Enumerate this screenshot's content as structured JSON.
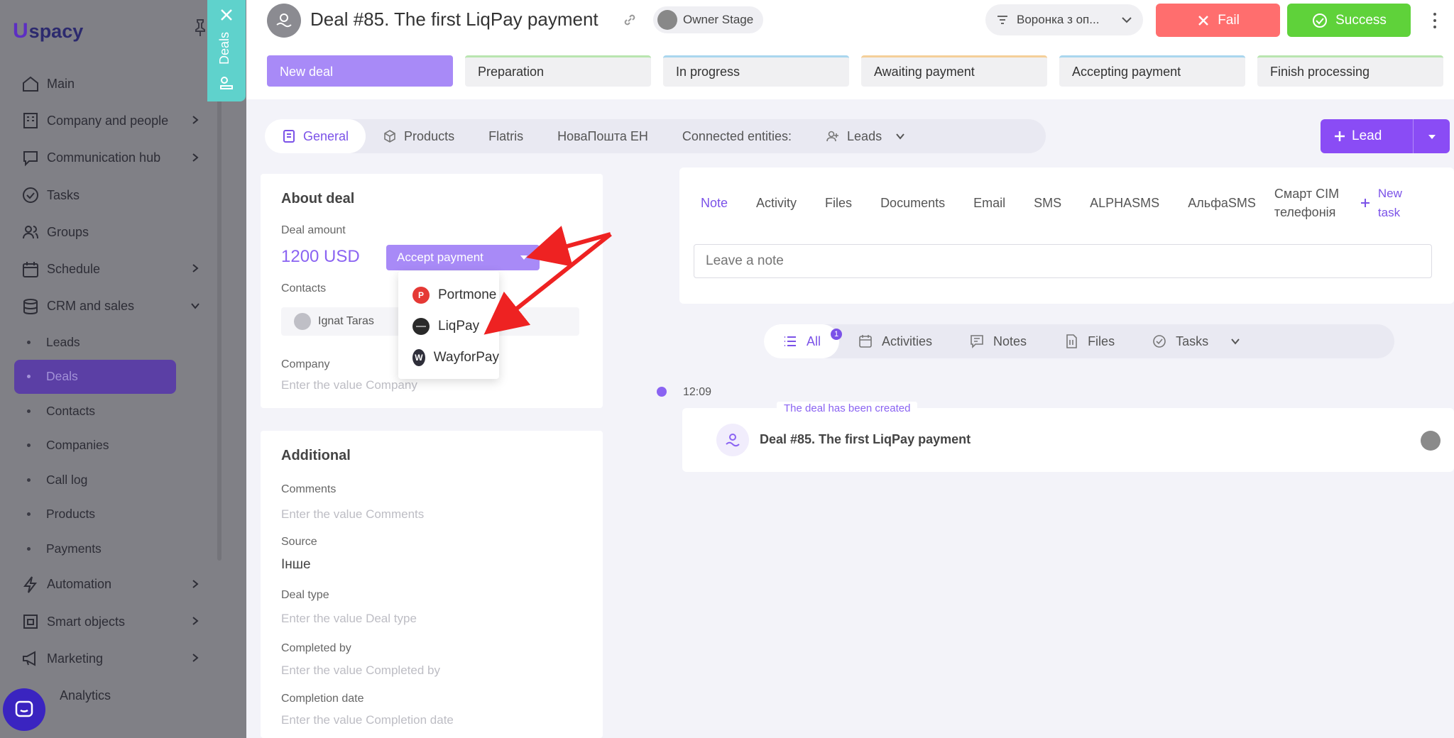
{
  "sidebar": {
    "logo": "spacy",
    "logo_mark": "U",
    "items": [
      {
        "label": "Main",
        "icon": "home-icon"
      },
      {
        "label": "Company and people",
        "icon": "building-icon",
        "expandable": true
      },
      {
        "label": "Communication hub",
        "icon": "chat-icon",
        "expandable": true
      },
      {
        "label": "Tasks",
        "icon": "check-circle-icon"
      },
      {
        "label": "Groups",
        "icon": "users-icon"
      },
      {
        "label": "Schedule",
        "icon": "calendar-icon",
        "expandable": true
      },
      {
        "label": "CRM and sales",
        "icon": "database-icon",
        "expanded": true
      }
    ],
    "crm_sub": [
      "Leads",
      "Deals",
      "Contacts",
      "Companies",
      "Call log",
      "Products",
      "Payments"
    ],
    "items_after": [
      {
        "label": "Automation",
        "icon": "bolt-icon",
        "expandable": true
      },
      {
        "label": "Smart objects",
        "icon": "cube-icon",
        "expandable": true
      },
      {
        "label": "Marketing",
        "icon": "megaphone-icon",
        "expandable": true
      },
      {
        "label": "Analytics",
        "icon": "chart-icon"
      }
    ]
  },
  "deals_tab": {
    "label": "Deals"
  },
  "header": {
    "title": "Deal #85. The first LiqPay payment",
    "owner_stage": "Owner Stage",
    "funnel": "Воронка з оп...",
    "fail_label": "Fail",
    "success_label": "Success"
  },
  "stages": [
    {
      "label": "New deal",
      "color": "#a88af7",
      "active": true
    },
    {
      "label": "Preparation",
      "color": "#b9e5b0"
    },
    {
      "label": "In progress",
      "color": "#a9d6ee"
    },
    {
      "label": "Awaiting payment",
      "color": "#f4cf99"
    },
    {
      "label": "Accepting payment",
      "color": "#a9d6ee"
    },
    {
      "label": "Finish processing",
      "color": "#b9e5b0"
    }
  ],
  "tabs": {
    "general": "General",
    "products": "Products",
    "flatris": "Flatris",
    "novaposhta": "НоваПошта ЕН",
    "connected": "Connected entities:",
    "leads": "Leads"
  },
  "lead_button": "Lead",
  "about": {
    "heading": "About deal",
    "deal_amount_label": "Deal amount",
    "deal_amount": "1200 USD",
    "accept_payment": "Accept payment",
    "contacts_label": "Contacts",
    "contact_name": "Ignat Taras",
    "company_label": "Company",
    "company_placeholder": "Enter the value Company"
  },
  "payment_menu": [
    {
      "label": "Portmone",
      "color": "#e53935",
      "mark": "P"
    },
    {
      "label": "LiqPay",
      "color": "#2a2a2a",
      "mark": ""
    },
    {
      "label": "WayforPay",
      "color": "#2f2f3a",
      "mark": "W"
    }
  ],
  "additional": {
    "heading": "Additional",
    "comments_label": "Comments",
    "comments_placeholder": "Enter the value Comments",
    "source_label": "Source",
    "source_value": "Інше",
    "deal_type_label": "Deal type",
    "deal_type_placeholder": "Enter the value Deal type",
    "completed_by_label": "Completed by",
    "completed_by_placeholder": "Enter the value Completed by",
    "completion_date_label": "Completion date",
    "completion_date_placeholder": "Enter the value Completion date"
  },
  "activity_tabs": [
    "Note",
    "Activity",
    "Files",
    "Documents",
    "Email",
    "SMS",
    "ALPHASMS",
    "АльфаSMS",
    "Смарт СІМ телефонія"
  ],
  "new_task": {
    "line1": "New",
    "line2": "task"
  },
  "note_placeholder": "Leave a note",
  "filters": {
    "all": "All",
    "all_count": "1",
    "activities": "Activities",
    "notes": "Notes",
    "files": "Files",
    "tasks": "Tasks"
  },
  "timeline": {
    "time": "12:09",
    "tag": "The deal has been created",
    "event_title": "Deal #85. The first LiqPay payment"
  },
  "colors": {
    "accent": "#8a4cf5",
    "fail": "#ff6e6e",
    "success": "#5fd23a",
    "arrow": "#ee2222",
    "deals_tab": "#5fd2cc"
  }
}
